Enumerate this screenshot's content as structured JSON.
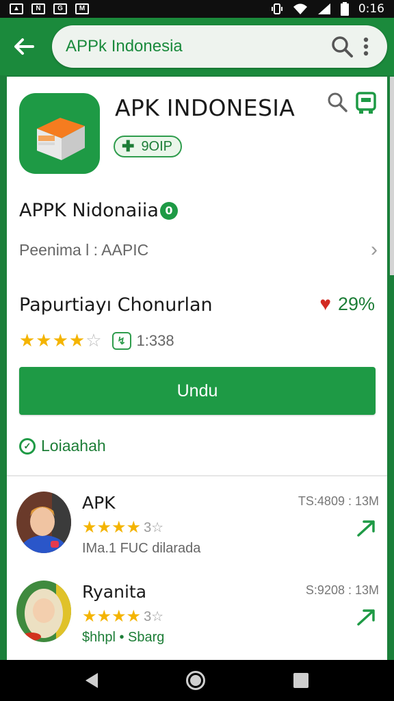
{
  "status_bar": {
    "time": "0:16"
  },
  "search": {
    "text": "APPk Indonesia"
  },
  "app": {
    "title": "APK INDONESIA",
    "chip_label": "9OIP",
    "subtitle": "APPK Nidonaiia",
    "info": "Peenima l : AAPIC",
    "developer": "Papurtiayı Chonurlan",
    "likes_percent": "29%",
    "rating_stars": 4.5,
    "downloads": "1:338",
    "install_label": "Undu",
    "verified_label": "Loiaahah"
  },
  "reviews": [
    {
      "name": "APK",
      "meta": "TS:4809 : 13M",
      "rating_text": "3☆",
      "stars": 4,
      "sub": "IMa.1 FUC dilarada"
    },
    {
      "name": "Ryanita",
      "meta": "S:9208 : 13M",
      "rating_text": "3☆",
      "stars": 4,
      "sub": "$hhpl • Sbarg"
    }
  ],
  "colors": {
    "primary": "#1e9a45",
    "app_bar": "#1b8a3c",
    "star": "#f4b400",
    "heart": "#d32a22"
  }
}
